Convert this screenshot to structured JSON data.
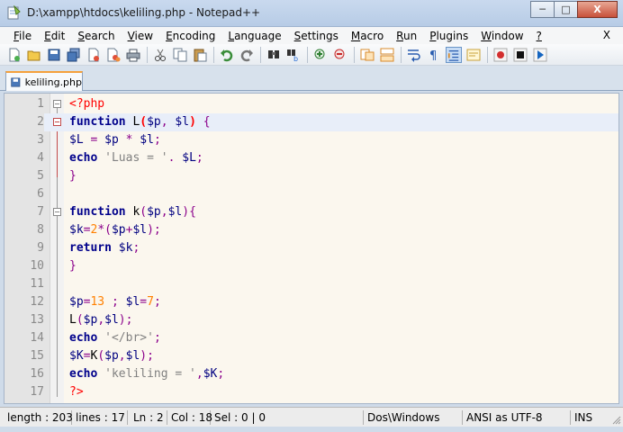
{
  "window": {
    "title": "D:\\xampp\\htdocs\\keliling.php - Notepad++",
    "minimize": "─",
    "maximize": "□",
    "close": "X"
  },
  "menu": {
    "items": [
      "File",
      "Edit",
      "Search",
      "View",
      "Encoding",
      "Language",
      "Settings",
      "Macro",
      "Run",
      "Plugins",
      "Window",
      "?"
    ],
    "close": "X"
  },
  "toolbar": {
    "icons": [
      "new-file-icon",
      "open-file-icon",
      "save-icon",
      "save-all-icon",
      "close-icon",
      "close-all-icon",
      "print-icon",
      "cut-icon",
      "copy-icon",
      "paste-icon",
      "undo-icon",
      "redo-icon",
      "find-icon",
      "replace-icon",
      "zoom-in-icon",
      "zoom-out-icon",
      "sync-v-icon",
      "sync-h-icon",
      "word-wrap-icon",
      "show-all-chars-icon",
      "indent-guide-icon",
      "user-lang-icon",
      "record-macro-icon",
      "stop-macro-icon",
      "play-macro-icon"
    ]
  },
  "tab": {
    "label": "keliling.php"
  },
  "editor": {
    "lines": [
      {
        "n": "1",
        "text": "<?php"
      },
      {
        "n": "2",
        "text": "function L($p, $l) {"
      },
      {
        "n": "3",
        "text": "$L = $p * $l;"
      },
      {
        "n": "4",
        "text": "echo 'Luas = '. $L;"
      },
      {
        "n": "5",
        "text": "}"
      },
      {
        "n": "6",
        "text": ""
      },
      {
        "n": "7",
        "text": "function k($p,$l){"
      },
      {
        "n": "8",
        "text": "$k=2*($p+$l);"
      },
      {
        "n": "9",
        "text": "return $k;"
      },
      {
        "n": "10",
        "text": "}"
      },
      {
        "n": "11",
        "text": ""
      },
      {
        "n": "12",
        "text": "$p=13 ; $l=7;"
      },
      {
        "n": "13",
        "text": "L($p,$l);"
      },
      {
        "n": "14",
        "text": "echo '</br>';"
      },
      {
        "n": "15",
        "text": "$K=K($p,$l);"
      },
      {
        "n": "16",
        "text": "echo 'keliling = ',$K;"
      },
      {
        "n": "17",
        "text": "?>"
      }
    ],
    "current_line": 2
  },
  "status": {
    "length": "length : 203",
    "lines": "lines : 17",
    "ln": "Ln : 2",
    "col": "Col : 18",
    "sel": "Sel : 0 | 0",
    "eol": "Dos\\Windows",
    "encoding": "ANSI as UTF-8",
    "mode": "INS"
  }
}
